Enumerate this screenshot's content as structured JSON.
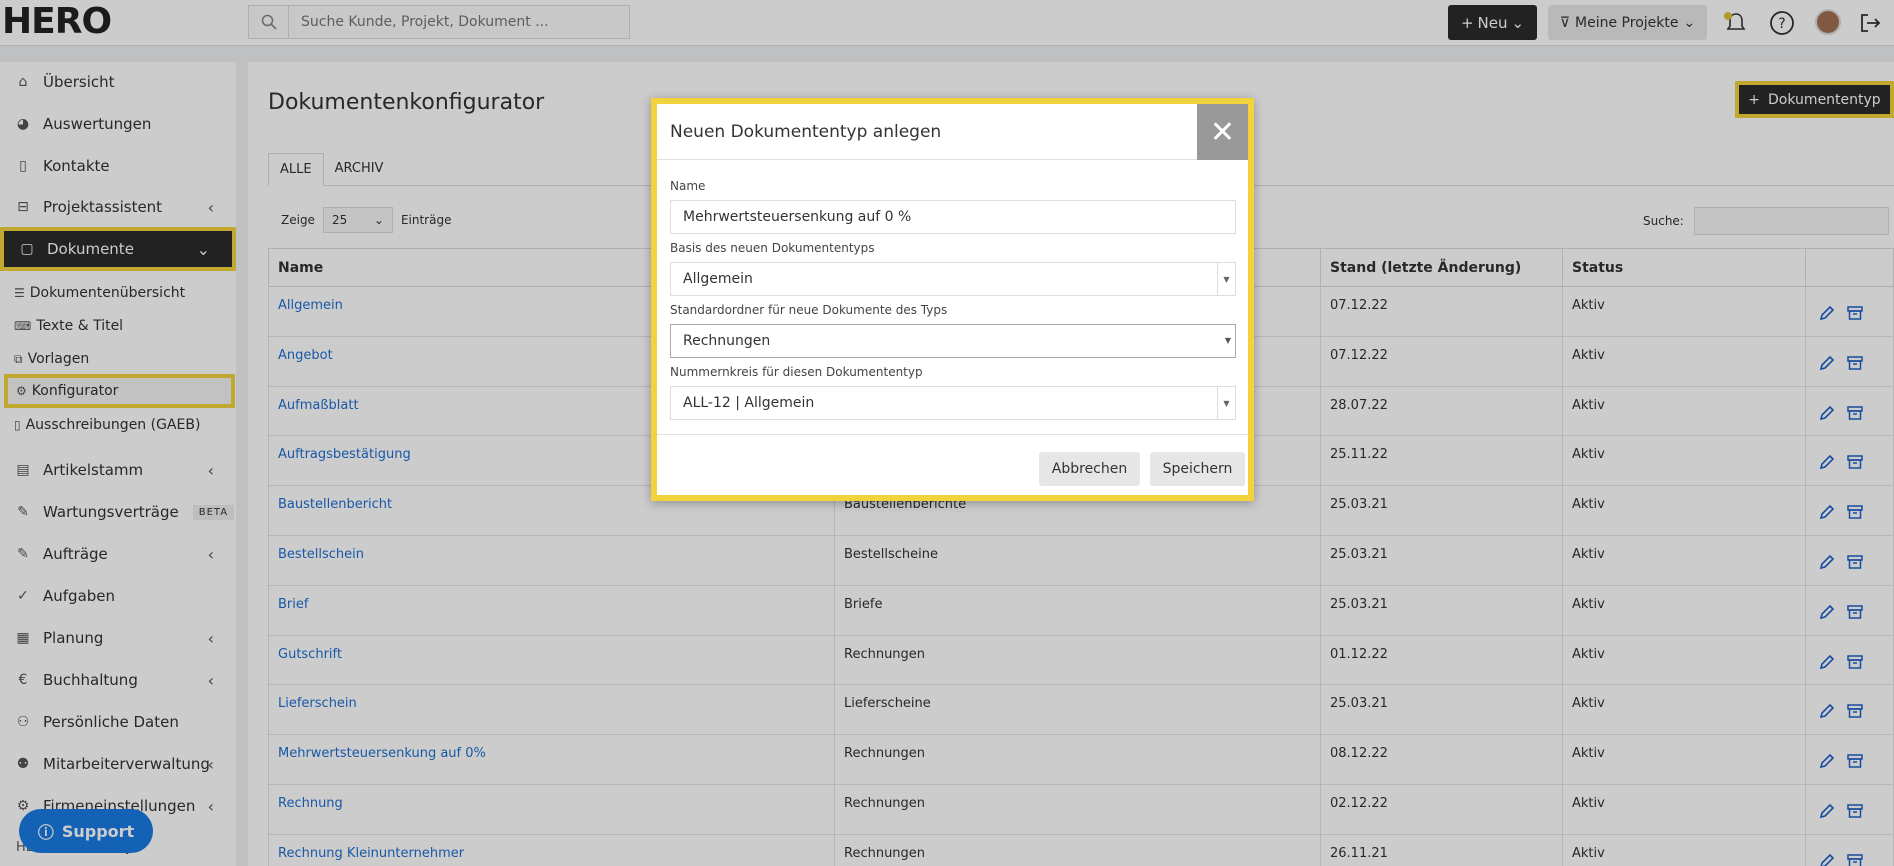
{
  "topbar": {
    "logo": "HERO",
    "search_placeholder": "Suche Kunde, Projekt, Dokument ...",
    "new_label": "Neu",
    "filter_label": "Meine Projekte"
  },
  "sidebar": {
    "items": [
      {
        "label": "Übersicht"
      },
      {
        "label": "Auswertungen"
      },
      {
        "label": "Kontakte"
      },
      {
        "label": "Projektassistent"
      },
      {
        "label": "Dokumente"
      },
      {
        "label": "Artikelstamm"
      },
      {
        "label": "Wartungsverträge",
        "badge": "BETA"
      },
      {
        "label": "Aufträge"
      },
      {
        "label": "Aufgaben"
      },
      {
        "label": "Planung"
      },
      {
        "label": "Buchhaltung"
      },
      {
        "label": "Persönliche Daten"
      },
      {
        "label": "Mitarbeiterverwaltung"
      },
      {
        "label": "Firmeneinstellungen"
      }
    ],
    "subitems": [
      {
        "label": "Dokumentenübersicht"
      },
      {
        "label": "Texte & Titel"
      },
      {
        "label": "Vorlagen"
      },
      {
        "label": "Konfigurator"
      },
      {
        "label": "Ausschreibungen (GAEB)"
      }
    ],
    "footer": "HERO Community",
    "support": "Support"
  },
  "main": {
    "title": "Dokumentenkonfigurator",
    "add_button": "Dokumententyp",
    "tabs": [
      {
        "label": "ALLE"
      },
      {
        "label": "ARCHIV"
      }
    ],
    "length": {
      "before": "Zeige",
      "value": "25",
      "after": "Einträge"
    },
    "search_label": "Suche:",
    "columns": [
      "Name",
      "",
      "Stand (letzte Änderung)",
      "Status",
      ""
    ],
    "rows": [
      {
        "name": "Allgemein",
        "folder": "",
        "date": "07.12.22",
        "status": "Aktiv"
      },
      {
        "name": "Angebot",
        "folder": "",
        "date": "07.12.22",
        "status": "Aktiv"
      },
      {
        "name": "Aufmaßblatt",
        "folder": "",
        "date": "28.07.22",
        "status": "Aktiv"
      },
      {
        "name": "Auftragsbestätigung",
        "folder": "",
        "date": "25.11.22",
        "status": "Aktiv"
      },
      {
        "name": "Baustellenbericht",
        "folder": "Baustellenberichte",
        "date": "25.03.21",
        "status": "Aktiv"
      },
      {
        "name": "Bestellschein",
        "folder": "Bestellscheine",
        "date": "25.03.21",
        "status": "Aktiv"
      },
      {
        "name": "Brief",
        "folder": "Briefe",
        "date": "25.03.21",
        "status": "Aktiv"
      },
      {
        "name": "Gutschrift",
        "folder": "Rechnungen",
        "date": "01.12.22",
        "status": "Aktiv"
      },
      {
        "name": "Lieferschein",
        "folder": "Lieferscheine",
        "date": "25.03.21",
        "status": "Aktiv"
      },
      {
        "name": "Mehrwertsteuersenkung auf 0%",
        "folder": "Rechnungen",
        "date": "08.12.22",
        "status": "Aktiv"
      },
      {
        "name": "Rechnung",
        "folder": "Rechnungen",
        "date": "02.12.22",
        "status": "Aktiv"
      },
      {
        "name": "Rechnung Kleinunternehmer",
        "folder": "Rechnungen",
        "date": "26.11.21",
        "status": "Aktiv"
      }
    ]
  },
  "modal": {
    "title": "Neuen Dokumententyp anlegen",
    "fields": [
      {
        "label": "Name",
        "value": "Mehrwertsteuersenkung auf 0 %"
      },
      {
        "label": "Basis des neuen Dokumententyps",
        "value": "Allgemein"
      },
      {
        "label": "Standardordner für neue Dokumente des Typs",
        "value": "Rechnungen"
      },
      {
        "label": "Nummernkreis für diesen Dokumententyp",
        "value": "ALL-12 | Allgemein"
      }
    ],
    "cancel": "Abbrechen",
    "save": "Speichern"
  }
}
